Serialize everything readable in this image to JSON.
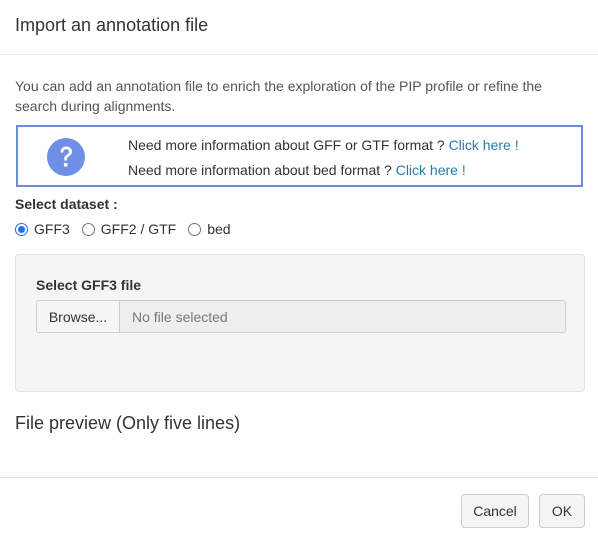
{
  "dialog": {
    "title": "Import an annotation file",
    "description": "You can add an annotation file to enrich the exploration of the PIP profile or refine the search during alignments."
  },
  "info": {
    "icon": "question-circle-icon",
    "line1_text": "Need more information about GFF or GTF format ?",
    "line1_link": "Click here !",
    "line2_text": "Need more information about bed format ?",
    "line2_link": "Click here !",
    "border_color": "#6b8be0",
    "icon_color": "#6f8ee6"
  },
  "dataset": {
    "label": "Select dataset :",
    "options": [
      {
        "label": "GFF3",
        "checked": true
      },
      {
        "label": "GFF2 / GTF",
        "checked": false
      },
      {
        "label": "bed",
        "checked": false
      }
    ]
  },
  "file_select": {
    "label": "Select GFF3 file",
    "browse_label": "Browse...",
    "placeholder": "No file selected"
  },
  "preview": {
    "title": "File preview (Only five lines)"
  },
  "footer": {
    "cancel_label": "Cancel",
    "ok_label": "OK"
  }
}
